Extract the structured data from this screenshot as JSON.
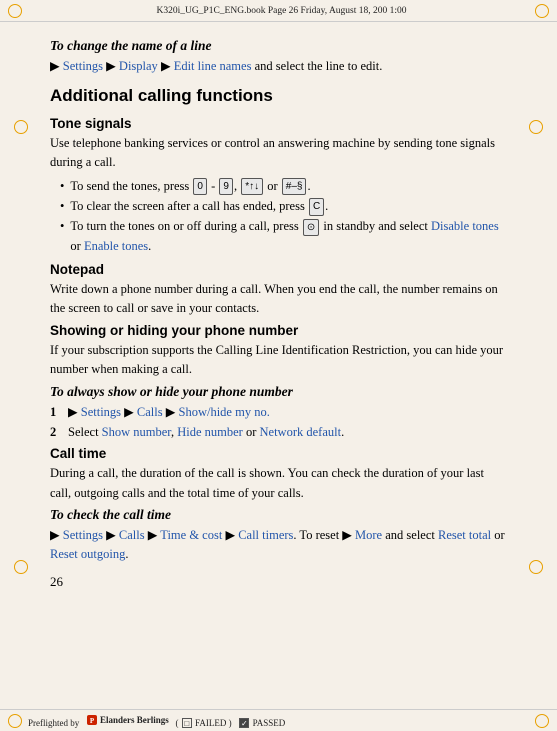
{
  "page": {
    "number": "26",
    "top_bar_text": "K320i_UG_P1C_ENG.book  Page 26  Friday, August 18, 200   1:00  ",
    "preflight_text": "Preflighted by",
    "preflight_company": "Elanders Berlings",
    "preflight_failed_label": "FAILED",
    "preflight_passed_label": "PASSED"
  },
  "section1": {
    "heading": "To change the name of a line",
    "breadcrumb_parts": [
      "Settings",
      "Display",
      "Edit line names"
    ],
    "breadcrumb_suffix": "and select the line to edit."
  },
  "section2": {
    "main_title": "Additional calling functions",
    "sub_sections": [
      {
        "id": "tone-signals",
        "title": "Tone signals",
        "body": "Use telephone banking services or control an answering machine by sending tone signals during a call.",
        "bullets": [
          {
            "text_before": "To send the tones, press",
            "keys": [
              "0",
              "-",
              "9",
              "*↑↓",
              "#–§"
            ],
            "text_after": ".",
            "full": "To send the tones, press [0] - [9], [*↑↓] or [#–§]."
          },
          {
            "full": "To clear the screen after a call has ended, press [C]."
          },
          {
            "full": "To turn the tones on or off during a call, press ⊙ in standby and select Disable tones or Enable tones.",
            "colored": [
              "Disable tones",
              "Enable tones"
            ]
          }
        ]
      },
      {
        "id": "notepad",
        "title": "Notepad",
        "body": "Write down a phone number during a call. When you end the call, the number remains on the screen to call or save in your contacts."
      },
      {
        "id": "showing-hiding",
        "title": "Showing or hiding your phone number",
        "body": "If your subscription supports the Calling Line Identification Restriction, you can hide your number when making a call."
      },
      {
        "id": "always-show-hide",
        "heading": "To always show or hide your phone number",
        "steps": [
          {
            "num": "1",
            "text": "▶ Settings ▶ Calls ▶ Show/hide my no.",
            "colored_parts": [
              "Settings",
              "Calls",
              "Show/hide my no."
            ]
          },
          {
            "num": "2",
            "text": "Select Show number, Hide number or Network default.",
            "colored_parts": [
              "Show number",
              "Hide number",
              "Network default"
            ]
          }
        ]
      },
      {
        "id": "call-time",
        "title": "Call time",
        "body": "During a call, the duration of the call is shown. You can check the duration of your last call, outgoing calls and the total time of your calls."
      },
      {
        "id": "check-call-time",
        "heading": "To check the call time",
        "breadcrumb_parts": [
          "Settings",
          "Calls",
          "Time & cost",
          "Call timers"
        ],
        "breadcrumb_suffix": ". To reset ▶ More and select Reset total or Reset outgoing.",
        "colored_reset": [
          "More",
          "Reset total",
          "Reset outgoing"
        ]
      }
    ]
  }
}
